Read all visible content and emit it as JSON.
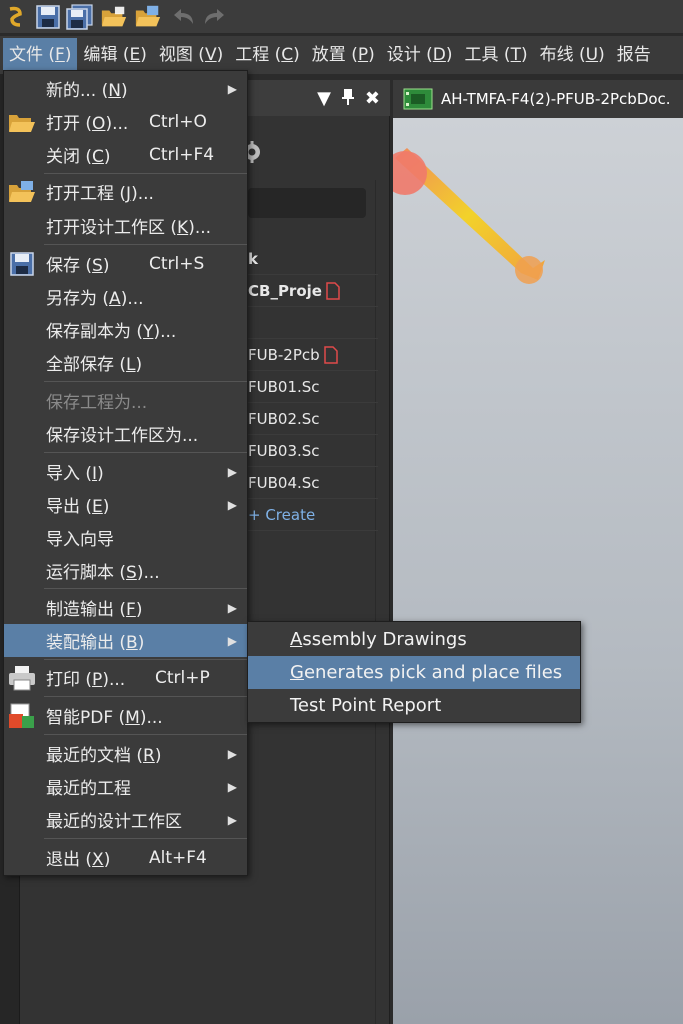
{
  "menubar": {
    "items": [
      {
        "text": "文件 (",
        "key": "F",
        "tail": ")"
      },
      {
        "text": "编辑 (",
        "key": "E",
        "tail": ")"
      },
      {
        "text": "视图 (",
        "key": "V",
        "tail": ")"
      },
      {
        "text": "工程 (",
        "key": "C",
        "tail": ")"
      },
      {
        "text": "放置 (",
        "key": "P",
        "tail": ")"
      },
      {
        "text": "设计 (",
        "key": "D",
        "tail": ")"
      },
      {
        "text": "工具 (",
        "key": "T",
        "tail": ")"
      },
      {
        "text": "布线 (",
        "key": "U",
        "tail": ")"
      },
      {
        "text": "报告",
        "key": "",
        "tail": ""
      }
    ]
  },
  "file_menu": {
    "new": {
      "text": "新的... (",
      "key": "N",
      "tail": ")"
    },
    "open": {
      "text": "打开 (",
      "key": "O",
      "tail": ")...",
      "shortcut": "Ctrl+O"
    },
    "close": {
      "text": "关闭 (",
      "key": "C",
      "tail": ")",
      "shortcut": "Ctrl+F4"
    },
    "open_project": {
      "text": "打开工程 (",
      "key": "J",
      "tail": ")..."
    },
    "open_workspace": {
      "text": "打开设计工作区 (",
      "key": "K",
      "tail": ")..."
    },
    "save": {
      "text": "保存 (",
      "key": "S",
      "tail": ")",
      "shortcut": "Ctrl+S"
    },
    "save_as": {
      "text": "另存为 (",
      "key": "A",
      "tail": ")..."
    },
    "save_copy_as": {
      "text": "保存副本为 (",
      "key": "Y",
      "tail": ")..."
    },
    "save_all": {
      "text": "全部保存 (",
      "key": "L",
      "tail": ")"
    },
    "save_project_as": {
      "text": "保存工程为..."
    },
    "save_workspace_as": {
      "text": "保存设计工作区为..."
    },
    "import": {
      "text": "导入 (",
      "key": "I",
      "tail": ")"
    },
    "export": {
      "text": "导出 (",
      "key": "E",
      "tail": ")"
    },
    "import_wizard": {
      "text": "导入向导"
    },
    "run_script": {
      "text": "运行脚本 (",
      "key": "S",
      "tail": ")..."
    },
    "fab_outputs": {
      "text": "制造输出 (",
      "key": "F",
      "tail": ")"
    },
    "assembly_outputs": {
      "text": "装配输出 (",
      "key": "B",
      "tail": ")"
    },
    "print": {
      "text": "打印 (",
      "key": "P",
      "tail": ")...",
      "shortcut": "Ctrl+P"
    },
    "smart_pdf": {
      "text": "智能PDF (",
      "key": "M",
      "tail": ")..."
    },
    "recent_docs": {
      "text": "最近的文档 (",
      "key": "R",
      "tail": ")"
    },
    "recent_projects": {
      "text": "最近的工程"
    },
    "recent_workspaces": {
      "text": "最近的设计工作区"
    },
    "exit": {
      "text": "退出 (",
      "key": "X",
      "tail": ")",
      "shortcut": "Alt+F4"
    }
  },
  "submenu": {
    "assembly_drawings": {
      "key": "A",
      "rest": "ssembly Drawings"
    },
    "pick_and_place": {
      "key": "G",
      "rest": "enerates pick and place files"
    },
    "test_point_report": {
      "text": "Test Point Report"
    }
  },
  "panel": {
    "rows": [
      {
        "text": "k",
        "style": "bold",
        "doc": false
      },
      {
        "text": "CB_Proje",
        "style": "bold",
        "doc": true
      },
      {
        "text": "",
        "style": "",
        "doc": false
      },
      {
        "text": "FUB-2Pcb",
        "style": "",
        "doc": true
      },
      {
        "text": "FUB01.Sc",
        "style": "",
        "doc": false
      },
      {
        "text": "FUB02.Sc",
        "style": "",
        "doc": false
      },
      {
        "text": "FUB03.Sc",
        "style": "",
        "doc": false
      },
      {
        "text": "FUB04.Sc",
        "style": "",
        "doc": false
      },
      {
        "text": "+ Create",
        "style": "link",
        "doc": false
      }
    ]
  },
  "doc_tab": {
    "label": "AH-TMFA-F4(2)-PFUB-2PcbDoc."
  },
  "colors": {
    "highlight": "#5a7fa6",
    "menu_bg": "#3b3b3b",
    "accent_orange": "#f5a623"
  }
}
